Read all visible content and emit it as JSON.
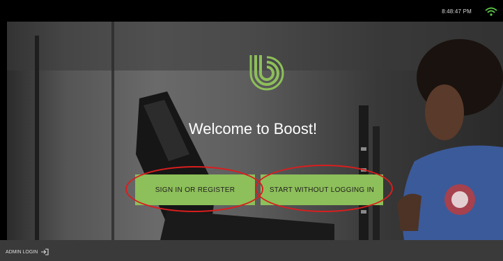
{
  "status_bar": {
    "time": "8:48:47 PM",
    "wifi_icon": "wifi-icon"
  },
  "brand": {
    "accent": "#8dbf5a",
    "logo_icon": "boost-logo-icon"
  },
  "welcome": {
    "text": "Welcome to Boost!"
  },
  "actions": {
    "sign_in_label": "SIGN IN OR REGISTER",
    "start_label": "START WITHOUT LOGGING IN"
  },
  "annotation": {
    "color": "#d91e1e"
  },
  "footer": {
    "admin_label": "ADMIN LOGIN",
    "admin_icon": "login-arrow-icon"
  }
}
